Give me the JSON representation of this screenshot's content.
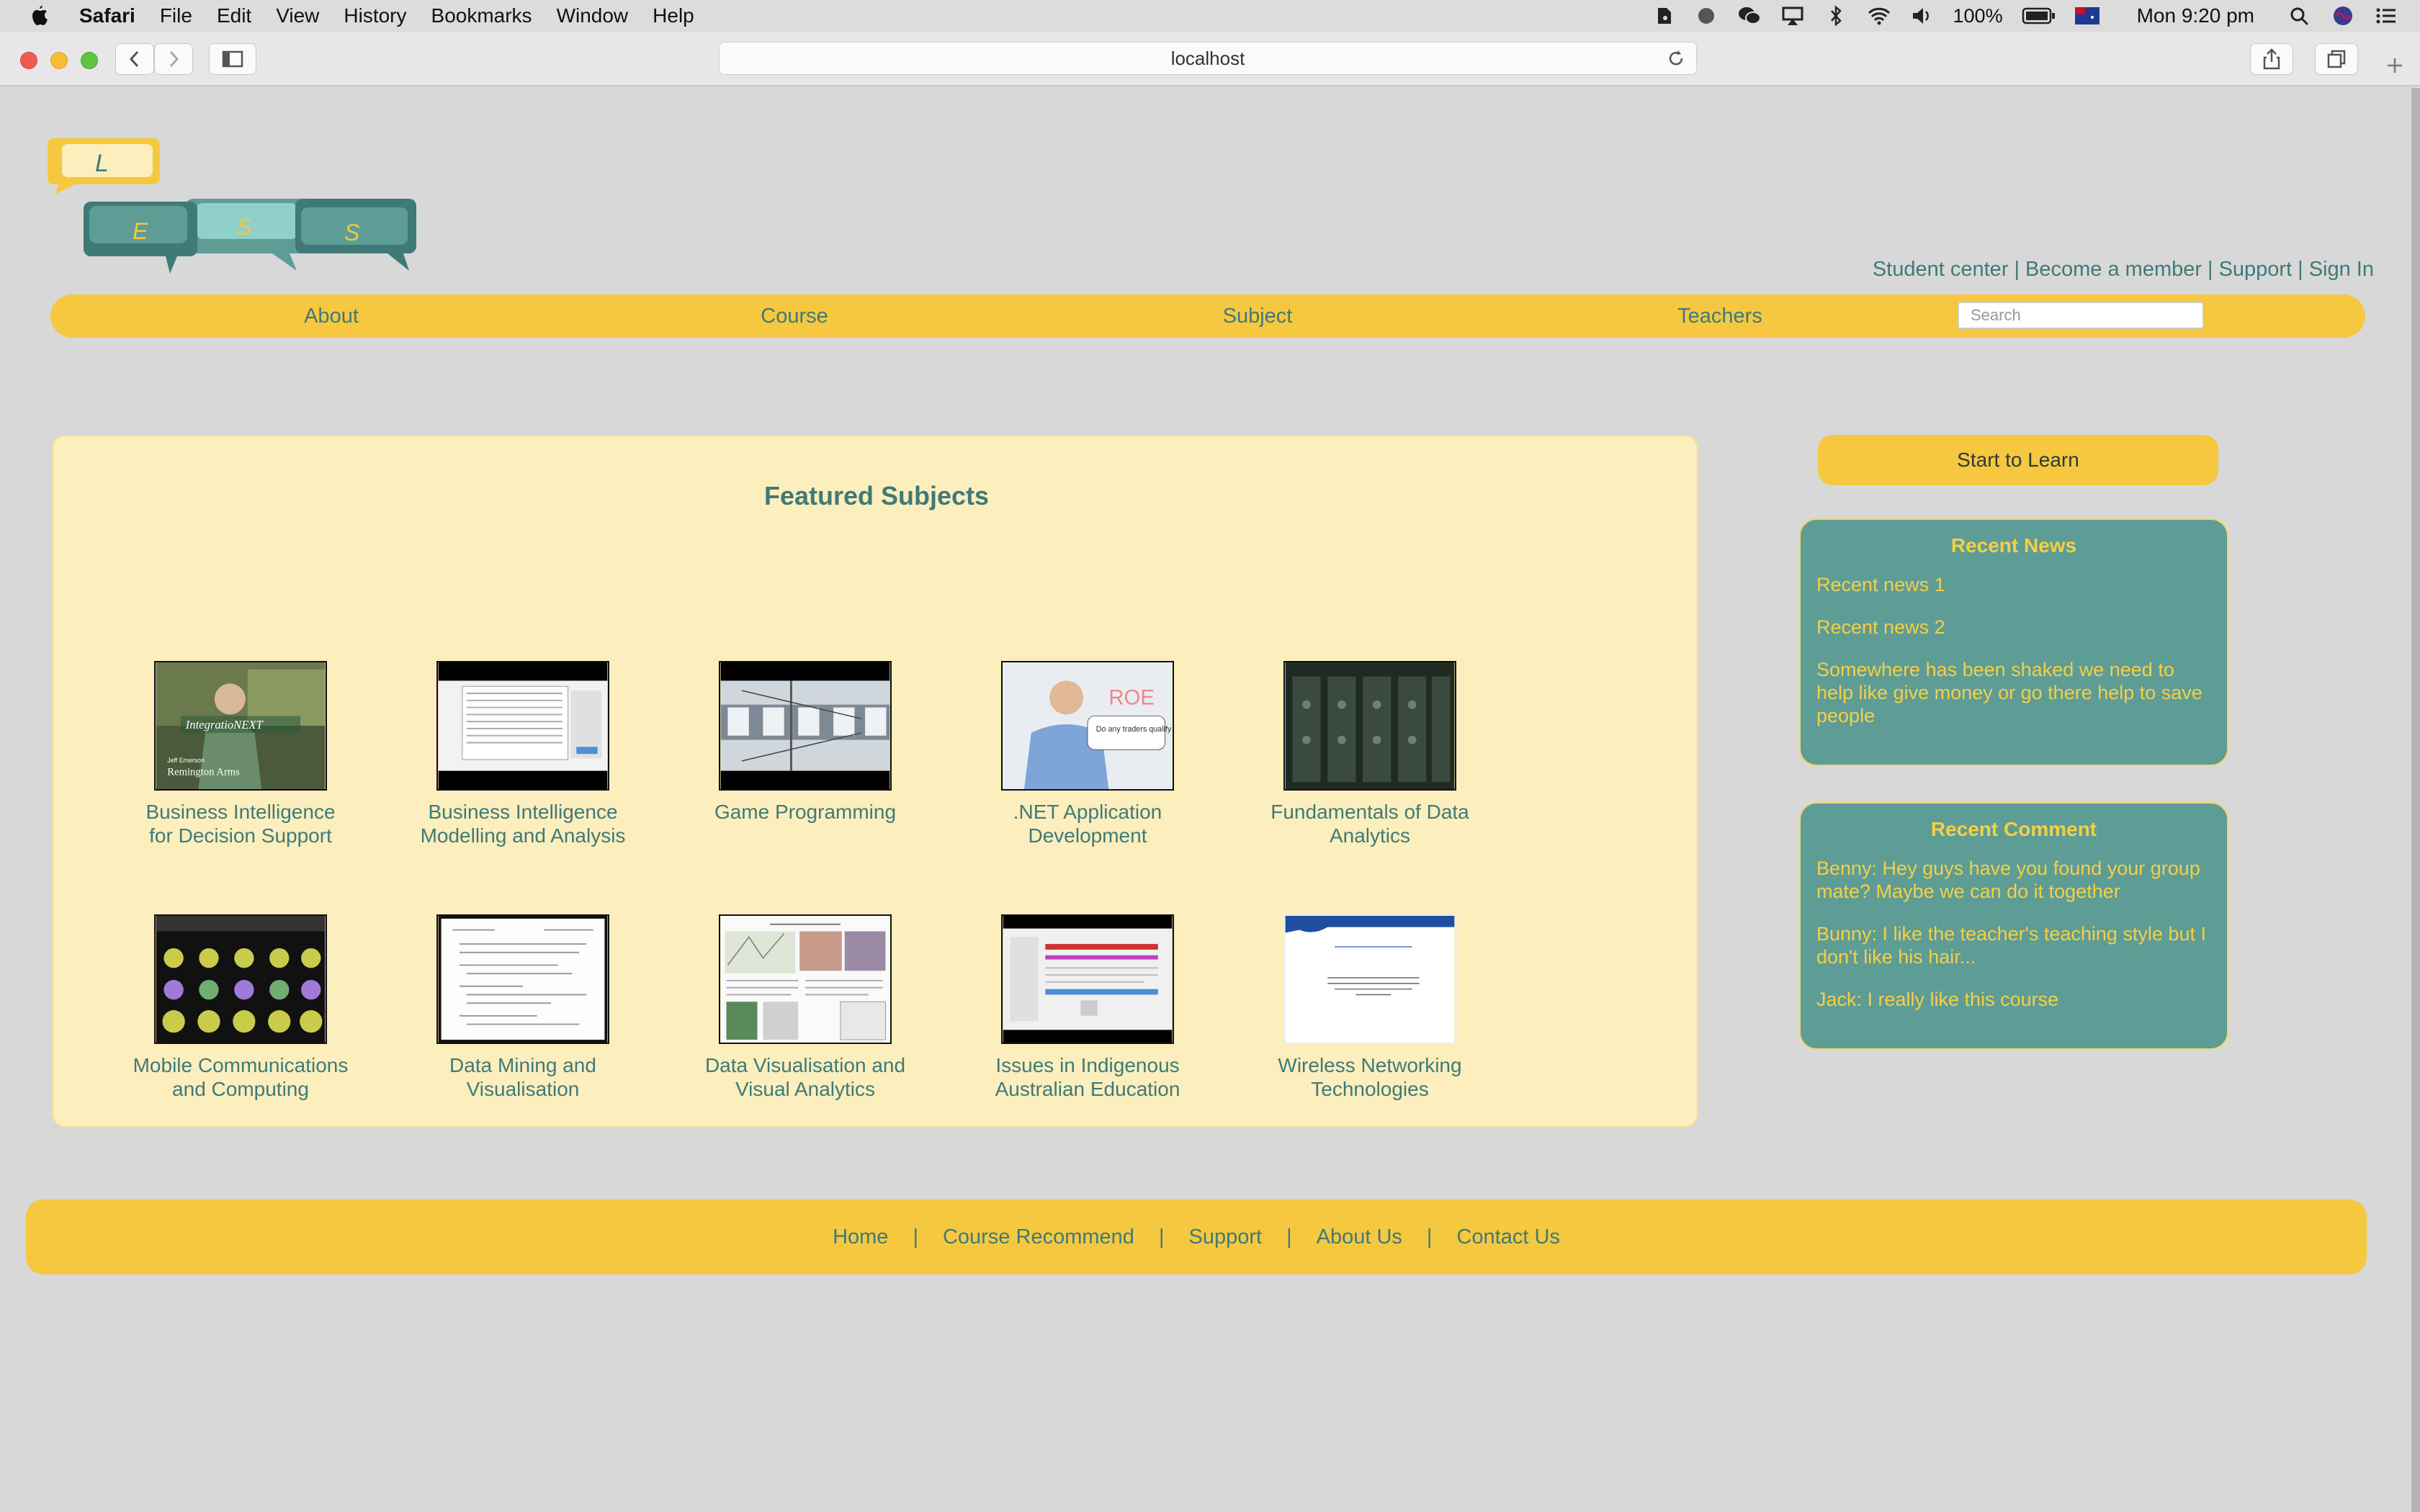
{
  "menubar": {
    "app_name": "Safari",
    "items": [
      "File",
      "Edit",
      "View",
      "History",
      "Bookmarks",
      "Window",
      "Help"
    ],
    "battery": "100%",
    "clock": "Mon 9:20 pm"
  },
  "browser": {
    "url": "localhost"
  },
  "logo": {
    "letters": [
      "L",
      "S",
      "E",
      "S"
    ]
  },
  "toplinks": [
    "Student center",
    "Become a member",
    "Support",
    "Sign In"
  ],
  "nav": {
    "items": [
      "About",
      "Course",
      "Subject",
      "Teachers"
    ],
    "search_placeholder": "Search"
  },
  "featured": {
    "title": "Featured Subjects",
    "subjects": [
      {
        "line1": "Business Intelligence",
        "line2": "for Decision Support"
      },
      {
        "line1": "Business Intelligence",
        "line2": "Modelling and Analysis"
      },
      {
        "line1": "Game Programming",
        "line2": ""
      },
      {
        "line1": ".NET Application",
        "line2": "Development"
      },
      {
        "line1": "Fundamentals of Data",
        "line2": "Analytics"
      },
      {
        "line1": "Mobile Communications",
        "line2": "and Computing"
      },
      {
        "line1": "Data Mining and",
        "line2": "Visualisation"
      },
      {
        "line1": "Data Visualisation and",
        "line2": "Visual Analytics"
      },
      {
        "line1": "Issues in Indigenous",
        "line2": "Australian Education"
      },
      {
        "line1": "Wireless Networking",
        "line2": "Technologies"
      }
    ],
    "thumb_texts": {
      "bi_overlay": "IntegratioNEXT",
      "bi_name": "Jeff Emerson",
      "bi_company": "Remington Arms",
      "net_whiteboard": "ROE",
      "net_card": "Do any traders qualify as a startup?"
    }
  },
  "sidebar": {
    "start_label": "Start to Learn",
    "news_title": "Recent News",
    "news": [
      "Recent news 1",
      "Recent news 2",
      "Somewhere has been shaked we need to help like give money or go there help to save people"
    ],
    "comment_title": "Recent Comment",
    "comments": [
      "Benny: Hey guys have you found your group mate? Maybe we can do it together",
      "Bunny: I like the teacher's teaching style but I don't like his hair...",
      "Jack: I really like this course"
    ]
  },
  "footer": {
    "links": [
      "Home",
      "Course Recommend",
      "Support",
      "About Us",
      "Contact Us"
    ]
  },
  "colors": {
    "accent_yellow": "#f5c83f",
    "teal": "#3f7a78",
    "panel_teal": "#5e9d96",
    "cream": "#fdeebd"
  }
}
